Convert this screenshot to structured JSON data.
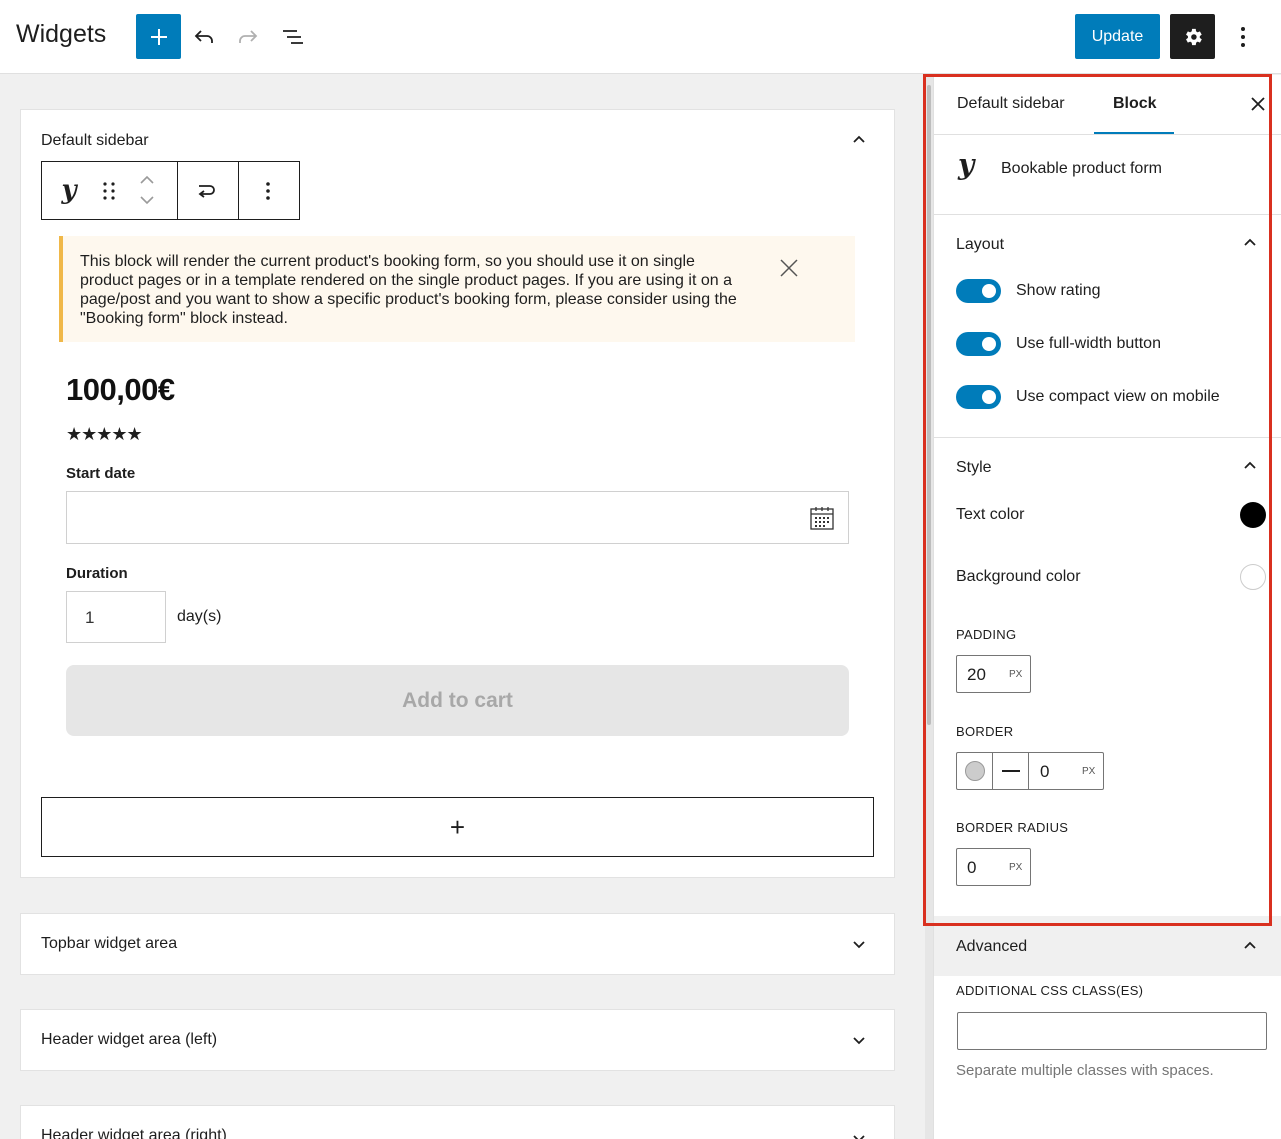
{
  "topbar": {
    "title": "Widgets",
    "update_label": "Update",
    "icons": [
      "plus-icon",
      "undo-icon",
      "redo-icon",
      "list-view-icon",
      "gear-icon",
      "more-vertical-icon"
    ]
  },
  "panels": {
    "default_sidebar": "Default sidebar",
    "topbar": "Topbar widget area",
    "header_left": "Header widget area (left)",
    "header_right": "Header widget area (right)"
  },
  "block": {
    "notice": "This block will render the current product's booking form, so you should use it on single product pages or in a template rendered on the single product pages. If you are using it on a page/post and you want to show a specific product's booking form, please consider using the \"Booking form\" block instead.",
    "price": "100,00€",
    "stars": "★★★★★",
    "start_date_label": "Start date",
    "duration_label": "Duration",
    "duration_value": "1",
    "duration_unit": "day(s)",
    "add_to_cart": "Add to cart",
    "appender_symbol": "+"
  },
  "sidebar": {
    "tabs": [
      "Default sidebar",
      "Block"
    ],
    "active_tab": "Block",
    "block_name": "Bookable product form",
    "layout": {
      "title": "Layout",
      "toggles": [
        {
          "label": "Show rating",
          "on": true
        },
        {
          "label": "Use full-width button",
          "on": true
        },
        {
          "label": "Use compact view on mobile",
          "on": true
        }
      ]
    },
    "style": {
      "title": "Style",
      "text_color_label": "Text color",
      "text_color": "#000000",
      "background_color_label": "Background color",
      "background_color": "#ffffff",
      "padding_label": "PADDING",
      "padding_value": "20",
      "padding_unit": "PX",
      "border_label": "BORDER",
      "border_value": "0",
      "border_unit": "PX",
      "border_radius_label": "BORDER RADIUS",
      "border_radius_value": "0",
      "border_radius_unit": "PX"
    },
    "advanced": {
      "title": "Advanced",
      "css_label": "ADDITIONAL CSS CLASS(ES)",
      "css_value": "",
      "help": "Separate multiple classes with spaces."
    }
  },
  "colors": {
    "accent": "#007cba",
    "highlight": "#d9301f",
    "notice_bg": "#fef8ee",
    "notice_border": "#f0b849"
  }
}
